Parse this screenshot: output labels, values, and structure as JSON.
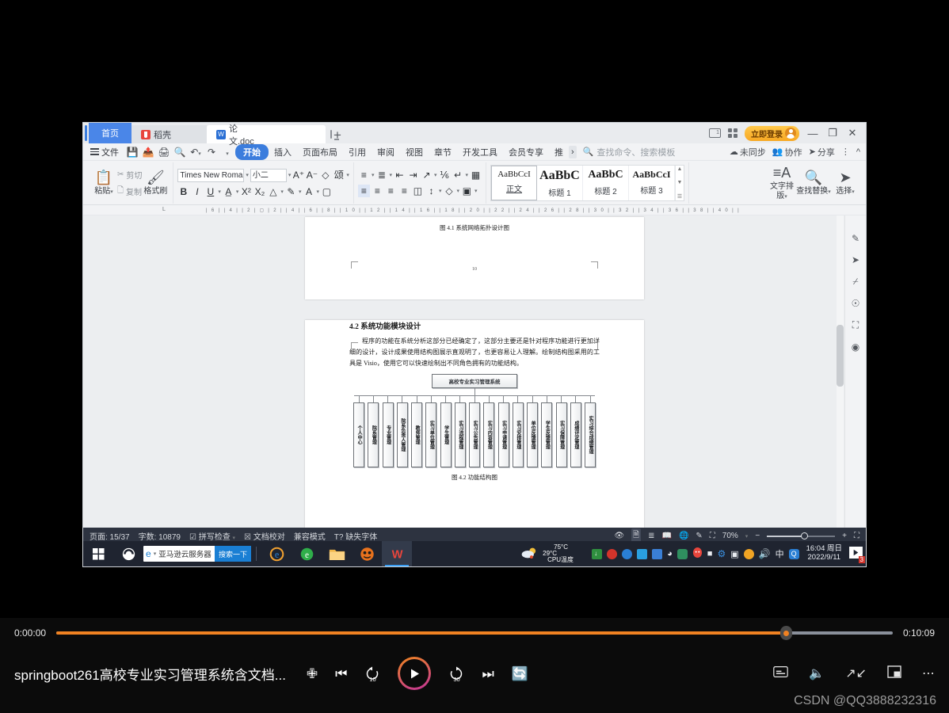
{
  "window": {
    "tabs": [
      {
        "name": "首页",
        "type": "home"
      },
      {
        "name": "稻壳",
        "type": "gray",
        "icon": "docer-icon"
      },
      {
        "name": "论文.doc",
        "type": "active",
        "icon": "wps-doc-icon"
      }
    ],
    "new_tab": "+",
    "login_button": "立即登录",
    "controls": {
      "minimize": "—",
      "restore": "❐",
      "close": "✕"
    }
  },
  "menu": {
    "file": "文件",
    "quick_icons": [
      "save-icon",
      "save-as-icon",
      "print-icon",
      "print-preview-icon",
      "undo-icon",
      "redo-icon",
      "customize-icon"
    ],
    "items": [
      "开始",
      "插入",
      "页面布局",
      "引用",
      "审阅",
      "视图",
      "章节",
      "开发工具",
      "会员专享",
      "推"
    ],
    "active_item": "开始",
    "search_placeholder": "查找命令、搜索模板",
    "right_items": [
      "未同步",
      "协作",
      "分享"
    ]
  },
  "ribbon": {
    "clipboard": {
      "paste": "粘贴",
      "cut": "剪切",
      "copy": "复制",
      "format_painter": "格式刷"
    },
    "font": {
      "family": "Times New Roma",
      "size": "小二"
    },
    "styles": [
      {
        "sample": "AaBbCcI",
        "name": "正文"
      },
      {
        "sample": "AaBbC",
        "name": "标题 1"
      },
      {
        "sample": "AaBbC",
        "name": "标题 2"
      },
      {
        "sample": "AaBbCcI",
        "name": "标题 3"
      }
    ],
    "text_layout": "文字排版",
    "find_replace": "查找替换",
    "select": "选择"
  },
  "document": {
    "page1": {
      "caption": "图 4.1  系统网络拓扑设计图",
      "page_number": "10"
    },
    "page2": {
      "heading": "4.2 系统功能模块设计",
      "paragraph": "程序的功能在系统分析这部分已经确定了，这部分主要还是针对程序功能进行更加详细的设计，设计成果使用结构图展示直观明了，也更容易让人理解。绘制结构图采用的工具是 Visio，使用它可以快速绘制出不同角色拥有的功能结构。",
      "caption": "图 4.2  功能结构图"
    }
  },
  "chart_data": {
    "type": "diagram",
    "title": "图 4.2  功能结构图",
    "root": "高校专业实习管理系统",
    "leaves": [
      "个人中心",
      "院系管理",
      "专业管理",
      "院系负责人管理",
      "教师管理",
      "实习单位管理",
      "学生管理",
      "实习流程管理",
      "实习公告管理",
      "实习内容管理",
      "实习申请管理",
      "实习安排管理",
      "单位反馈管理",
      "学生反馈管理",
      "实习保障管理",
      "成绩评定管理",
      "实习综合成绩管理"
    ]
  },
  "status_bar": {
    "page": "页面: 15/37",
    "words": "字数: 10879",
    "spell_check": "拼写检查",
    "proofread": "文档校对",
    "compat_mode": "兼容模式",
    "missing_font": "缺失字体",
    "zoom": "70%",
    "zoom_out": "−",
    "zoom_in": "+"
  },
  "taskbar": {
    "search_value": "亚马逊云服务器",
    "search_button": "搜索一下",
    "weather_temp": "29°C",
    "cpu_temp": "75°C",
    "cpu_label": "CPU温度",
    "ime": "中",
    "time": "16:04 周日",
    "date": "2022/9/11",
    "notification_count": "3"
  },
  "player": {
    "current_time": "0:00:00",
    "duration": "0:10:09",
    "progress_percent": 87,
    "title": "springboot261高校专业实习管理系统含文档...",
    "controls": [
      "shuffle-icon",
      "previous-icon",
      "rewind-10-icon",
      "play-icon",
      "forward-30-icon",
      "next-icon",
      "repeat-off-icon"
    ],
    "rewind_seconds": "10",
    "forward_seconds": "30",
    "right_controls": [
      "subtitles-icon",
      "volume-icon",
      "fullscreen-icon",
      "pip-icon",
      "more-icon"
    ],
    "watermark": "CSDN @QQ3888232316"
  }
}
